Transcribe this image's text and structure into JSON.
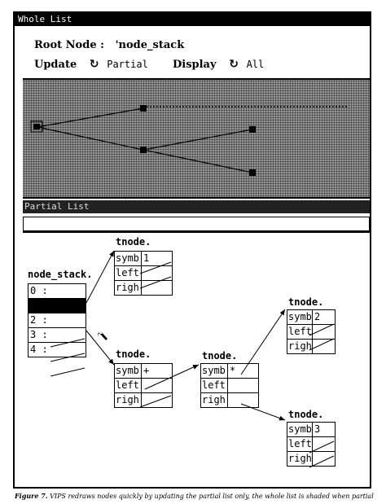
{
  "window": {
    "title": "Whole List"
  },
  "controls": {
    "root_label": "Root Node :",
    "root_value": "'node_stack",
    "update_label": "Update",
    "update_value": "Partial",
    "display_label": "Display",
    "display_value": "All",
    "cycle_glyph": "↻"
  },
  "partial": {
    "title": "Partial List"
  },
  "graph": {
    "stack": {
      "name": "node_stack.",
      "rows": [
        "0 :",
        "",
        "2 :",
        "3 :",
        "4 :"
      ]
    },
    "nodes": {
      "top": {
        "title": "tnode.",
        "symb_label": "symb",
        "symb_value": "1",
        "left_label": "left",
        "righ_label": "righ"
      },
      "mid": {
        "title": "tnode.",
        "symb_label": "symb",
        "symb_value": "+",
        "left_label": "left",
        "righ_label": "righ"
      },
      "center": {
        "title": "tnode.",
        "symb_label": "symb",
        "symb_value": "*",
        "left_label": "left",
        "righ_label": "righ"
      },
      "right_top": {
        "title": "tnode.",
        "symb_label": "symb",
        "symb_value": "2",
        "left_label": "left",
        "righ_label": "righ"
      },
      "right_bottom": {
        "title": "tnode.",
        "symb_label": "symb",
        "symb_value": "3",
        "left_label": "left",
        "righ_label": "righ"
      }
    }
  },
  "caption": {
    "figure": "Figure 7.",
    "text": "VIPS redraws nodes quickly by updating the partial list only, the whole list is shaded when partial"
  }
}
